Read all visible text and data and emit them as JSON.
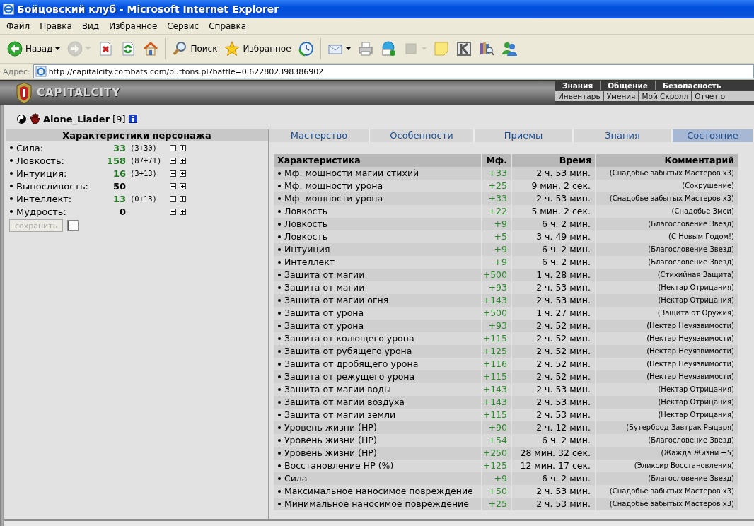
{
  "window": {
    "title": "Бойцовский клуб - Microsoft Internet Explorer"
  },
  "menu": [
    "Файл",
    "Правка",
    "Вид",
    "Избранное",
    "Сервис",
    "Справка"
  ],
  "toolbar": [
    {
      "kind": "back",
      "label": "Назад",
      "dropdown": true,
      "disabled": false
    },
    {
      "kind": "forward",
      "dropdown": true,
      "disabled": true
    },
    {
      "kind": "stop",
      "dropdown": false,
      "disabled": false
    },
    {
      "kind": "refresh",
      "dropdown": false,
      "disabled": false
    },
    {
      "kind": "home",
      "dropdown": false,
      "disabled": false
    },
    {
      "kind": "search",
      "label": "Поиск",
      "dropdown": false,
      "disabled": false
    },
    {
      "kind": "favorites",
      "label": "Избранное",
      "dropdown": false,
      "disabled": false
    },
    {
      "kind": "history",
      "dropdown": false,
      "disabled": false
    },
    {
      "kind": "mail",
      "dropdown": true,
      "disabled": false
    },
    {
      "kind": "print",
      "dropdown": false,
      "disabled": false
    },
    {
      "kind": "phone",
      "dropdown": false,
      "disabled": false
    },
    {
      "kind": "square",
      "dropdown": true,
      "disabled": true
    },
    {
      "kind": "note",
      "dropdown": false,
      "disabled": false
    },
    {
      "kind": "tile",
      "dropdown": false,
      "disabled": false
    },
    {
      "kind": "books",
      "dropdown": false,
      "disabled": false
    },
    {
      "kind": "people",
      "dropdown": false,
      "disabled": false
    }
  ],
  "address": {
    "label": "Адрес:",
    "value": "http://capitalcity.combats.com/buttons.pl?battle=0.622802398386902"
  },
  "site": {
    "logo": "CAPITALCITY",
    "nav_top": [
      "Знания",
      "Общение",
      "Безопасность"
    ],
    "nav_bottom": [
      "Инвентарь",
      "Умения",
      "Мой Скролл",
      "Отчет о"
    ]
  },
  "character": {
    "name": "Alone_Liader",
    "level": "[9]"
  },
  "stats": {
    "title": "Характеристики персонажа",
    "items": [
      {
        "name": "Сила:",
        "value": "33",
        "bonus": "(3+30)"
      },
      {
        "name": "Ловкость:",
        "value": "158",
        "bonus": "(87+71)"
      },
      {
        "name": "Интуиция:",
        "value": "16",
        "bonus": "(3+13)"
      },
      {
        "name": "Выносливость:",
        "value": "50"
      },
      {
        "name": "Интеллект:",
        "value": "13",
        "bonus": "(0+13)"
      },
      {
        "name": "Мудрость:",
        "value": "0"
      }
    ],
    "save_button": {
      "label": "сохранить",
      "disabled": true
    },
    "confirm_checkbox": {
      "checked": false
    }
  },
  "tabs": [
    {
      "label": "Мастерство",
      "selected": false
    },
    {
      "label": "Особенности",
      "selected": false
    },
    {
      "label": "Приемы",
      "selected": false
    },
    {
      "label": "Знания",
      "selected": false
    },
    {
      "label": "Состояние",
      "selected": true
    }
  ],
  "effects": {
    "columns": [
      "Характеристика",
      "Мф.",
      "Время",
      "Комментарий"
    ],
    "rows": [
      {
        "name": "Мф. мощности магии стихий",
        "mf": "+33",
        "time": "2 ч. 53 мин.",
        "comment": "(Снадобье забытых Мастеров x3)"
      },
      {
        "name": "Мф. мощности урона",
        "mf": "+25",
        "time": "9 мин. 2 сек.",
        "comment": "(Сокрушение)"
      },
      {
        "name": "Мф. мощности урона",
        "mf": "+33",
        "time": "2 ч. 53 мин.",
        "comment": "(Снадобье забытых Мастеров x3)"
      },
      {
        "name": "Ловкость",
        "mf": "+22",
        "time": "5 мин. 2 сек.",
        "comment": "(Снадобье Змеи)"
      },
      {
        "name": "Ловкость",
        "mf": "+9",
        "time": "6 ч. 2 мин.",
        "comment": "(Благословение Звезд)"
      },
      {
        "name": "Ловкость",
        "mf": "+5",
        "time": "3 ч. 49 мин.",
        "comment": "(С Новым Годом!)"
      },
      {
        "name": "Интуиция",
        "mf": "+9",
        "time": "6 ч. 2 мин.",
        "comment": "(Благословение Звезд)"
      },
      {
        "name": "Интеллект",
        "mf": "+9",
        "time": "6 ч. 2 мин.",
        "comment": "(Благословение Звезд)"
      },
      {
        "name": "Защита от магии",
        "mf": "+500",
        "time": "1 ч. 28 мин.",
        "comment": "(Стихийная Защита)"
      },
      {
        "name": "Защита от магии",
        "mf": "+93",
        "time": "2 ч. 53 мин.",
        "comment": "(Нектар Отрицания)"
      },
      {
        "name": "Защита от магии огня",
        "mf": "+143",
        "time": "2 ч. 53 мин.",
        "comment": "(Нектар Отрицания)"
      },
      {
        "name": "Защита от урона",
        "mf": "+500",
        "time": "1 ч. 27 мин.",
        "comment": "(Защита от Оружия)"
      },
      {
        "name": "Защита от урона",
        "mf": "+93",
        "time": "2 ч. 52 мин.",
        "comment": "(Нектар Неуязвимости)"
      },
      {
        "name": "Защита от колющего урона",
        "mf": "+115",
        "time": "2 ч. 52 мин.",
        "comment": "(Нектар Неуязвимости)"
      },
      {
        "name": "Защита от рубящего урона",
        "mf": "+125",
        "time": "2 ч. 52 мин.",
        "comment": "(Нектар Неуязвимости)"
      },
      {
        "name": "Защита от дробящего урона",
        "mf": "+116",
        "time": "2 ч. 52 мин.",
        "comment": "(Нектар Неуязвимости)"
      },
      {
        "name": "Защита от режущего урона",
        "mf": "+115",
        "time": "2 ч. 52 мин.",
        "comment": "(Нектар Неуязвимости)"
      },
      {
        "name": "Защита от магии воды",
        "mf": "+143",
        "time": "2 ч. 53 мин.",
        "comment": "(Нектар Отрицания)"
      },
      {
        "name": "Защита от магии воздуха",
        "mf": "+143",
        "time": "2 ч. 53 мин.",
        "comment": "(Нектар Отрицания)"
      },
      {
        "name": "Защита от магии земли",
        "mf": "+115",
        "time": "2 ч. 53 мин.",
        "comment": "(Нектар Отрицания)"
      },
      {
        "name": "Уровень жизни (HP)",
        "mf": "+90",
        "time": "2 ч. 12 мин.",
        "comment": "(Бутерброд Завтрак Рыцаря)"
      },
      {
        "name": "Уровень жизни (HP)",
        "mf": "+54",
        "time": "6 ч. 2 мин.",
        "comment": "(Благословение Звезд)"
      },
      {
        "name": "Уровень жизни (HP)",
        "mf": "+250",
        "time": "28 мин. 32 сек.",
        "comment": "(Жажда Жизни +5)"
      },
      {
        "name": "Восстановление HP (%)",
        "mf": "+125",
        "time": "12 мин. 17 сек.",
        "comment": "(Эликсир Восстановления)"
      },
      {
        "name": "Сила",
        "mf": "+9",
        "time": "6 ч. 2 мин.",
        "comment": "(Благословение Звезд)"
      },
      {
        "name": "Максимальное наносимое повреждение",
        "mf": "+50",
        "time": "2 ч. 53 мин.",
        "comment": "(Снадобье забытых Мастеров x3)"
      },
      {
        "name": "Минимальное наносимое повреждение",
        "mf": "+25",
        "time": "2 ч. 53 мин.",
        "comment": "(Снадобье забытых Мастеров x3)"
      }
    ]
  }
}
